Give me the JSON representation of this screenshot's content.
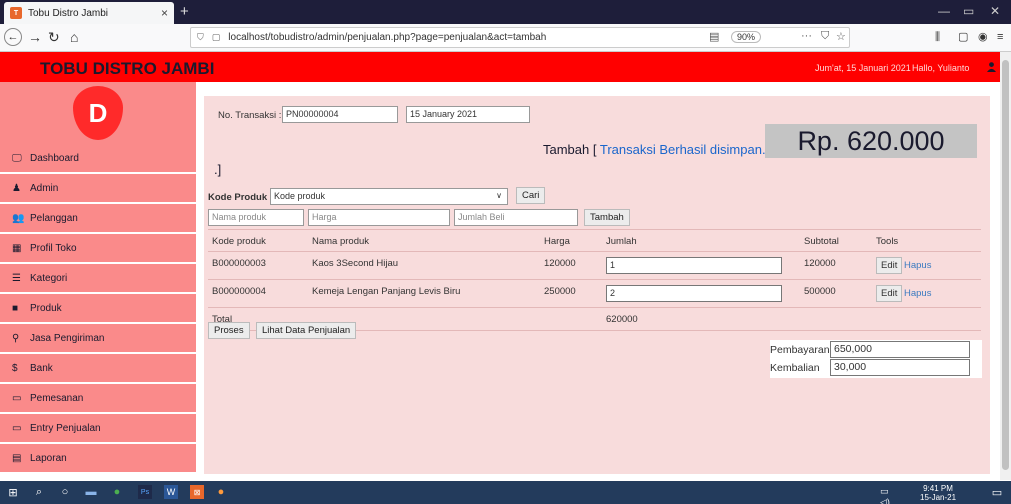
{
  "browser": {
    "tab_title": "Tobu Distro Jambi",
    "tab_close": "×",
    "new_tab": "+",
    "url": "localhost/tobudistro/admin/penjualan.php?page=penjualan&act=tambah",
    "zoom": "90%"
  },
  "header": {
    "brand": "TOBU DISTRO JAMBI",
    "date": "Jum'at, 15 Januari 2021",
    "greeting": "Hallo, Yulianto"
  },
  "sidebar": {
    "items": [
      {
        "label": "Dashboard",
        "icon": "monitor-icon",
        "glyph": "🖵"
      },
      {
        "label": "Admin",
        "icon": "user-icon",
        "glyph": "♟"
      },
      {
        "label": "Pelanggan",
        "icon": "users-icon",
        "glyph": "👥"
      },
      {
        "label": "Profil Toko",
        "icon": "grid-icon",
        "glyph": "▦"
      },
      {
        "label": "Kategori",
        "icon": "list-icon",
        "glyph": "☰"
      },
      {
        "label": "Produk",
        "icon": "briefcase-icon",
        "glyph": "■"
      },
      {
        "label": "Jasa Pengiriman",
        "icon": "map-marker-icon",
        "glyph": "⚲"
      },
      {
        "label": "Bank",
        "icon": "dollar-icon",
        "glyph": "$"
      },
      {
        "label": "Pemesanan",
        "icon": "credit-card-icon",
        "glyph": "▭"
      },
      {
        "label": "Entry Penjualan",
        "icon": "credit-card-icon",
        "glyph": "▭"
      },
      {
        "label": "Laporan",
        "icon": "report-icon",
        "glyph": "▤"
      }
    ]
  },
  "form": {
    "no_transaksi_label": "No. Transaksi :",
    "no_transaksi": "PN00000004",
    "tanggal": "15 January 2021",
    "message_prefix": "Tambah [",
    "message": " Transaksi Berhasil disimpan. .",
    "message_tail": ".]",
    "grand_total": "Rp. 620.000",
    "kode_produk_label": "Kode Produk",
    "kode_produk_select": "Kode produk",
    "cari_button": "Cari",
    "nama_placeholder": "Nama produk",
    "harga_placeholder": "Harga",
    "jumlah_placeholder": "Jumlah Beli",
    "tambah_button": "Tambah"
  },
  "table": {
    "headers": [
      "Kode produk",
      "Nama produk",
      "Harga",
      "Jumlah",
      "Subtotal",
      "Tools"
    ],
    "rows": [
      {
        "kode": "B000000003",
        "nama": "Kaos 3Second Hijau",
        "harga": "120000",
        "jumlah": "1",
        "subtotal": "120000"
      },
      {
        "kode": "B000000004",
        "nama": "Kemeja Lengan Panjang Levis Biru",
        "harga": "250000",
        "jumlah": "2",
        "subtotal": "500000"
      }
    ],
    "edit_label": "Edit",
    "hapus_label": "Hapus",
    "total_label": "Total",
    "total_value": "620000"
  },
  "actions": {
    "proses": "Proses",
    "lihat": "Lihat Data Penjualan"
  },
  "payment": {
    "pembayaran_label": "Pembayaran",
    "pembayaran": "650,000",
    "kembalian_label": "Kembalian",
    "kembalian": "30,000"
  },
  "taskbar": {
    "time": "9:41 PM",
    "date": "15-Jan-21"
  },
  "colors": {
    "header": "#ff0000",
    "sidebar": "#fa8a8a",
    "panel": "#f8dcdc",
    "brand_text": "#1a1a2e"
  }
}
